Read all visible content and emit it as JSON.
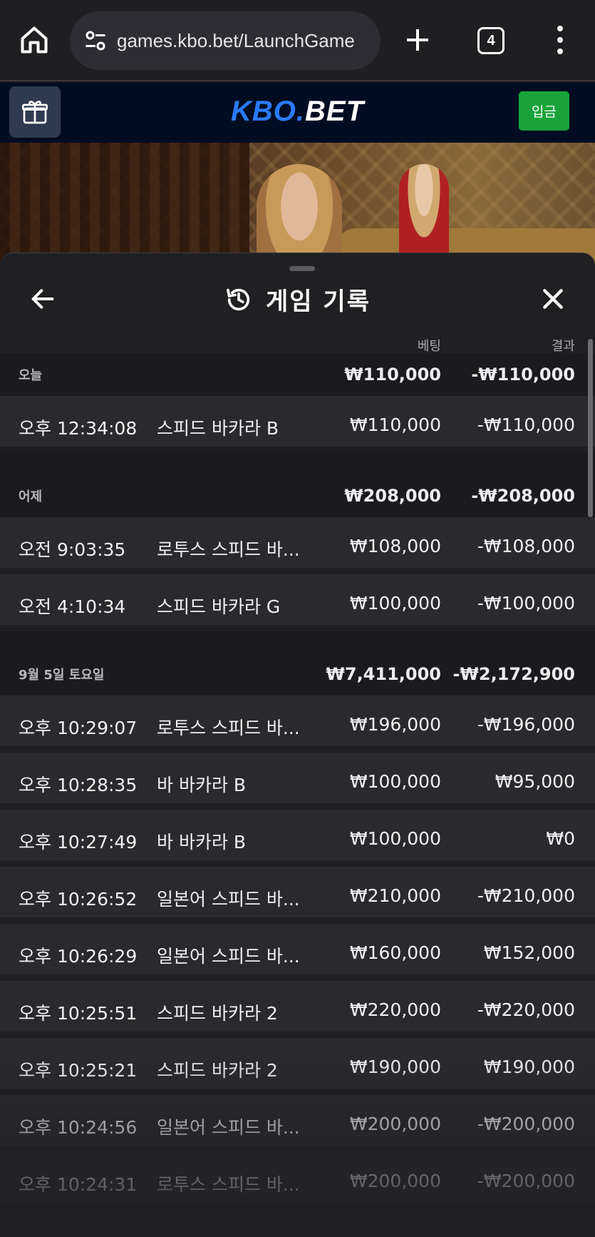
{
  "browser": {
    "url": "games.kbo.bet/LaunchGame",
    "tab_count": "4"
  },
  "header": {
    "logo_kbo": "KBO",
    "logo_dot": ".",
    "logo_bet": "BET",
    "deposit_label": "입금"
  },
  "sheet": {
    "title": "게임 기록",
    "col_bet": "베팅",
    "col_result": "결과",
    "groups": [
      {
        "label": "오늘",
        "bet_total": "₩110,000",
        "result_total": "-₩110,000",
        "rows": [
          {
            "time": "오후 12:34:08",
            "game": "스피드 바카라 B",
            "bet": "₩110,000",
            "result": "-₩110,000"
          }
        ]
      },
      {
        "label": "어제",
        "bet_total": "₩208,000",
        "result_total": "-₩208,000",
        "rows": [
          {
            "time": "오전 9:03:35",
            "game": "로투스 스피드 바...",
            "bet": "₩108,000",
            "result": "-₩108,000"
          },
          {
            "time": "오전 4:10:34",
            "game": "스피드 바카라 G",
            "bet": "₩100,000",
            "result": "-₩100,000"
          }
        ]
      },
      {
        "label": "9월 5일 토요일",
        "bet_total": "₩7,411,000",
        "result_total": "-₩2,172,900",
        "rows": [
          {
            "time": "오후 10:29:07",
            "game": "로투스 스피드 바...",
            "bet": "₩196,000",
            "result": "-₩196,000"
          },
          {
            "time": "오후 10:28:35",
            "game": "바 바카라 B",
            "bet": "₩100,000",
            "result": "₩95,000"
          },
          {
            "time": "오후 10:27:49",
            "game": "바 바카라 B",
            "bet": "₩100,000",
            "result": "₩0"
          },
          {
            "time": "오후 10:26:52",
            "game": "일본어 스피드 바...",
            "bet": "₩210,000",
            "result": "-₩210,000"
          },
          {
            "time": "오후 10:26:29",
            "game": "일본어 스피드 바...",
            "bet": "₩160,000",
            "result": "₩152,000"
          },
          {
            "time": "오후 10:25:51",
            "game": "스피드 바카라 2",
            "bet": "₩220,000",
            "result": "-₩220,000"
          },
          {
            "time": "오후 10:25:21",
            "game": "스피드 바카라 2",
            "bet": "₩190,000",
            "result": "₩190,000"
          },
          {
            "time": "오후 10:24:56",
            "game": "일본어 스피드 바...",
            "bet": "₩200,000",
            "result": "-₩200,000"
          },
          {
            "time": "오후 10:24:31",
            "game": "로투스 스피드 바...",
            "bet": "₩200,000",
            "result": "-₩200,000"
          }
        ]
      }
    ]
  },
  "icons": {
    "home": "home-icon",
    "tune": "tune-icon",
    "plus": "plus-icon",
    "tabs": "tabs-icon",
    "menu": "more-vert-icon",
    "gift": "gift-icon",
    "back": "arrow-left-icon",
    "history": "history-icon",
    "close": "close-icon"
  }
}
